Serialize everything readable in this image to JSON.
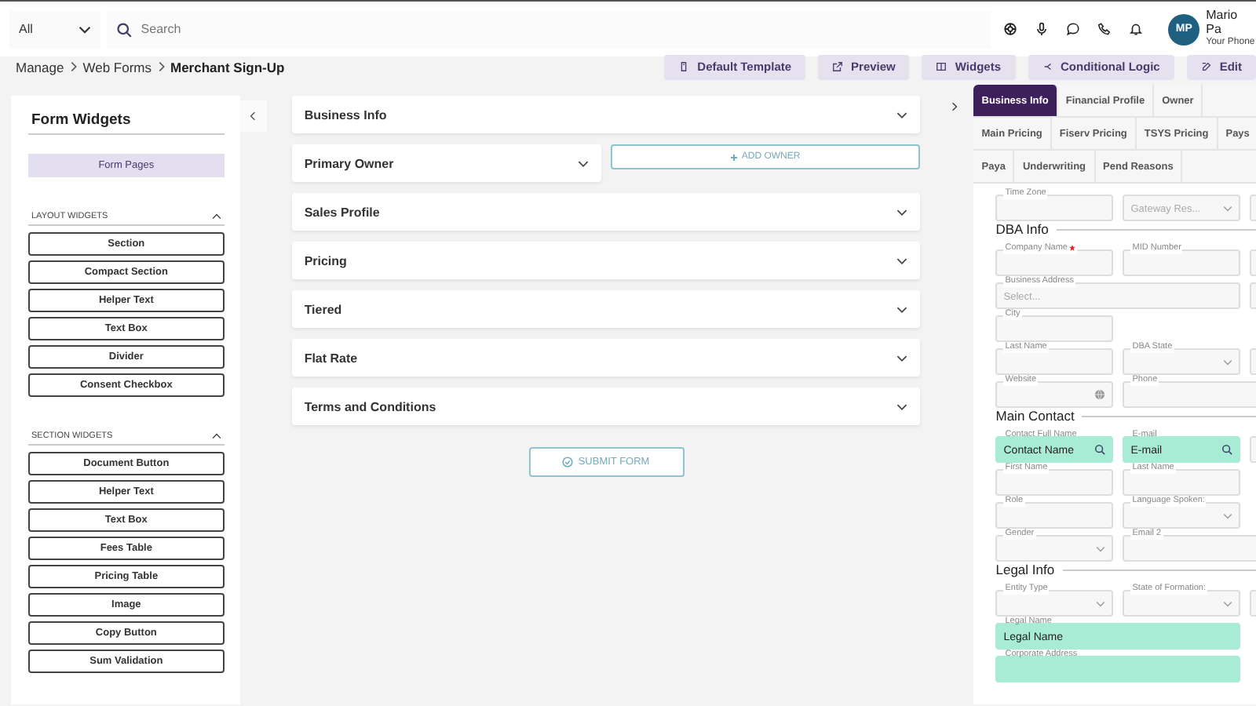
{
  "top_bar": {
    "scope_select": "All",
    "search": {
      "placeholder": "Search"
    },
    "user": {
      "initials": "MP",
      "name": "Mario Pa",
      "subtitle": "Your Phone"
    }
  },
  "breadcrumb": {
    "items": [
      "Manage",
      "Web Forms"
    ],
    "current": "Merchant Sign-Up"
  },
  "toolbar": [
    {
      "label": "Default Template",
      "kind": "template"
    },
    {
      "label": "Preview",
      "kind": "preview"
    },
    {
      "label": "Widgets",
      "kind": "widgets"
    },
    {
      "label": "Conditional Logic",
      "kind": "logic"
    },
    {
      "label": "Edit",
      "kind": "edit"
    }
  ],
  "widgets_panel": {
    "title": "Form Widgets",
    "pages_button": "Form Pages",
    "groups": [
      {
        "title": "LAYOUT WIDGETS",
        "expanded": true,
        "items": [
          "Section",
          "Compact Section",
          "Helper Text",
          "Text Box",
          "Divider",
          "Consent Checkbox"
        ]
      },
      {
        "title": "SECTION WIDGETS",
        "expanded": true,
        "items": [
          "Document Button",
          "Helper Text",
          "Text Box",
          "Fees Table",
          "Pricing Table",
          "Image",
          "Copy Button",
          "Sum Validation"
        ]
      }
    ]
  },
  "form_sections": [
    {
      "title": "Business Info",
      "expanded": false,
      "kind": "full"
    },
    {
      "title": "Primary Owner",
      "expanded": false,
      "kind": "half"
    },
    {
      "title": "Sales Profile",
      "expanded": false,
      "kind": "full"
    },
    {
      "title": "Pricing",
      "expanded": false,
      "kind": "full"
    },
    {
      "title": "Tiered",
      "expanded": false,
      "kind": "full"
    },
    {
      "title": "Flat Rate",
      "expanded": false,
      "kind": "full"
    },
    {
      "title": "Terms and Conditions",
      "expanded": false,
      "kind": "full"
    }
  ],
  "add_owner_button": "ADD OWNER",
  "submit_button": "SUBMIT FORM",
  "preview_panel": {
    "tab_rows": [
      [
        {
          "label": "Business Info",
          "selected": true
        },
        {
          "label": "Financial Profile",
          "selected": false
        },
        {
          "label": "Owner",
          "selected": false
        }
      ],
      [
        {
          "label": "Main Pricing",
          "selected": false
        },
        {
          "label": "Fiserv Pricing",
          "selected": false
        },
        {
          "label": "TSYS Pricing",
          "selected": false
        },
        {
          "label": "Pays",
          "selected": false
        }
      ],
      [
        {
          "label": "Paya",
          "selected": false
        },
        {
          "label": "Underwriting",
          "selected": false
        },
        {
          "label": "Pend Reasons",
          "selected": false
        }
      ]
    ],
    "rows": [
      {
        "kind": "fields",
        "fields": [
          {
            "kind": "text",
            "label": "Time Zone"
          },
          {
            "kind": "select",
            "placeholder": "Gateway Res..."
          },
          {
            "kind": "text"
          }
        ]
      },
      {
        "kind": "section",
        "title": "DBA Info"
      },
      {
        "kind": "fields",
        "fields": [
          {
            "kind": "text",
            "label": "Company Name",
            "required": true
          },
          {
            "kind": "text",
            "label": "MID Number"
          },
          {
            "kind": "text"
          }
        ]
      },
      {
        "kind": "fields",
        "fields": [
          {
            "kind": "text",
            "label": "Business Address",
            "placeholder": "Select...",
            "wide": true
          },
          {
            "kind": "text"
          }
        ]
      },
      {
        "kind": "fields",
        "fields": [
          {
            "kind": "text",
            "label": "City"
          }
        ]
      },
      {
        "kind": "fields",
        "fields": [
          {
            "kind": "text",
            "label": "Last Name"
          },
          {
            "kind": "select",
            "label": "DBA State"
          },
          {
            "kind": "text"
          }
        ]
      },
      {
        "kind": "fields",
        "fields": [
          {
            "kind": "globe",
            "label": "Website"
          },
          {
            "kind": "text",
            "label": "Phone",
            "wide": true
          }
        ]
      },
      {
        "kind": "section",
        "title": "Main Contact"
      },
      {
        "kind": "fields",
        "fields": [
          {
            "kind": "search",
            "label": "Contact Full Name",
            "value": "Contact Name",
            "highlighted": true
          },
          {
            "kind": "search",
            "label": "E-mail",
            "value": "E-mail",
            "highlighted": true
          },
          {
            "kind": "text"
          }
        ]
      },
      {
        "kind": "fields",
        "fields": [
          {
            "kind": "text",
            "label": "First Name"
          },
          {
            "kind": "text",
            "label": "Last Name"
          }
        ]
      },
      {
        "kind": "fields",
        "fields": [
          {
            "kind": "text",
            "label": "Role"
          },
          {
            "kind": "select",
            "label": "Language Spoken:"
          }
        ]
      },
      {
        "kind": "fields",
        "fields": [
          {
            "kind": "select",
            "label": "Gender"
          },
          {
            "kind": "text",
            "label": "Email 2",
            "wide": true
          }
        ]
      },
      {
        "kind": "section",
        "title": "Legal Info"
      },
      {
        "kind": "fields",
        "fields": [
          {
            "kind": "select",
            "label": "Entity Type"
          },
          {
            "kind": "select",
            "label": "State of Formation:"
          },
          {
            "kind": "text"
          }
        ]
      },
      {
        "kind": "fields",
        "fields": [
          {
            "kind": "text",
            "label": "Legal Name",
            "value": "Legal Name",
            "highlighted": true,
            "wide": true
          }
        ]
      },
      {
        "kind": "fields",
        "fields": [
          {
            "kind": "text",
            "label": "Corporate Address",
            "highlighted": true,
            "wide": true
          }
        ]
      }
    ]
  }
}
